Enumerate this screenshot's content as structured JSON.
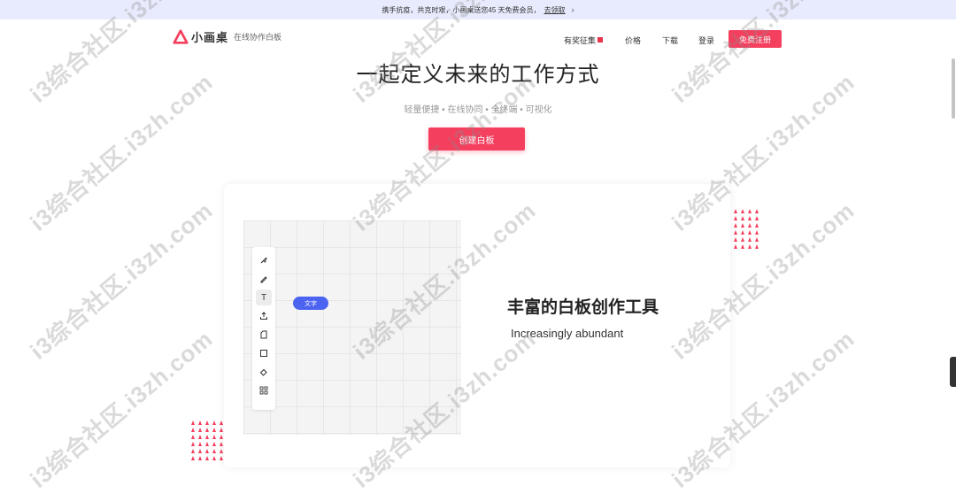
{
  "banner": {
    "text": "携手抗疫，共克时艰，小画桌送您45 天免费会员，",
    "link": "去领取",
    "chevron": "›"
  },
  "nav": {
    "logo_name": "小画桌",
    "logo_tagline": "在线协作白板",
    "contest": "有奖征集",
    "price": "价格",
    "download": "下载",
    "login": "登录",
    "signup": "免费注册"
  },
  "hero": {
    "title": "一起定义未来的工作方式",
    "subtitle": "轻量便捷 • 在线协同 • 全终端 • 可视化",
    "cta": "创建白板"
  },
  "feature": {
    "title": "丰富的白板创作工具",
    "subtitle": "Increasingly abundant",
    "chip": "文字",
    "tools": [
      "select-icon",
      "pen-icon",
      "text-icon",
      "upload-icon",
      "sticky-note-icon",
      "shape-icon",
      "eraser-icon",
      "grid-icon"
    ],
    "text_tool_glyph": "T"
  },
  "colors": {
    "accent": "#f43f5e",
    "chip": "#4b63f0",
    "banner_bg": "#e8ebfd"
  },
  "watermark": "i3综合社区.i3zh.com"
}
